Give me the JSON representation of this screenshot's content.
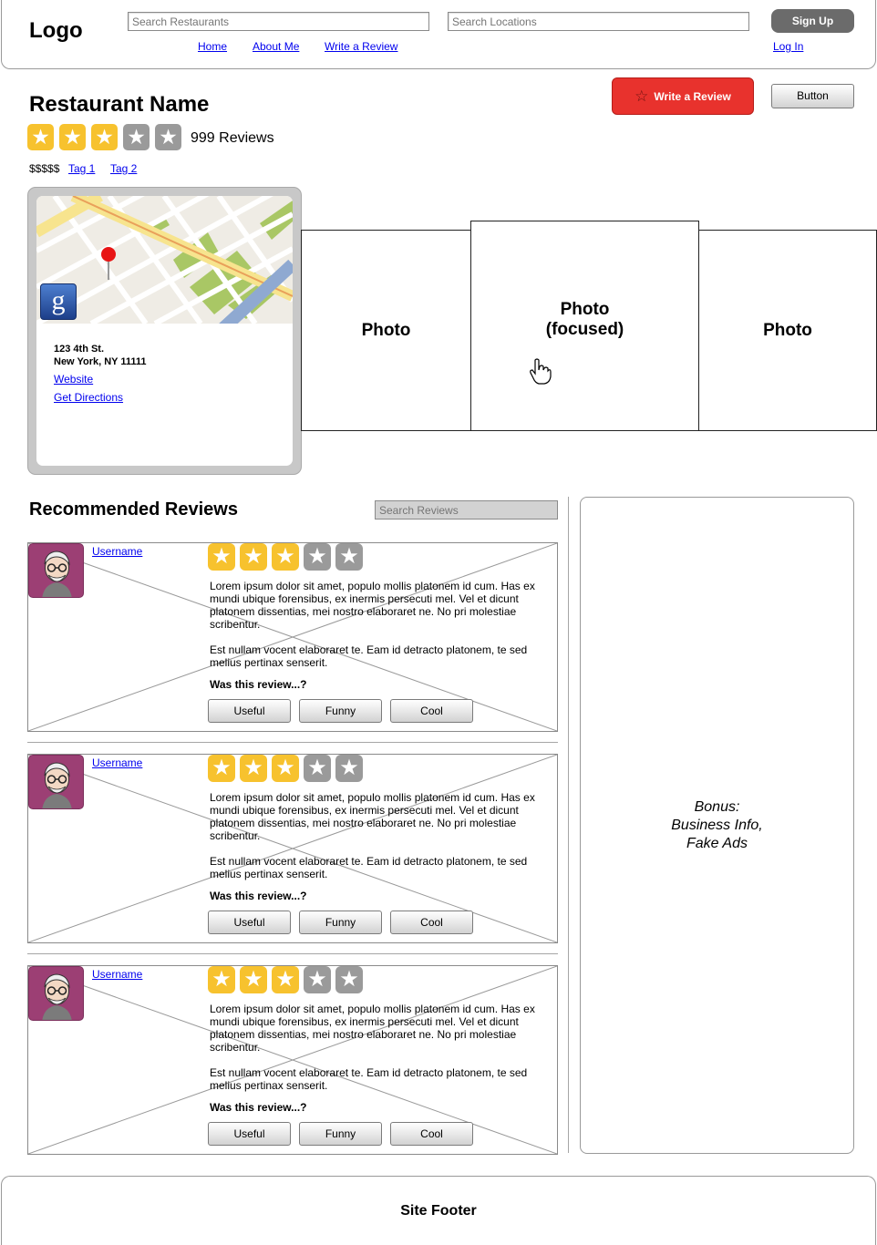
{
  "header": {
    "logo": "Logo",
    "search_restaurants_placeholder": "Search Restaurants",
    "search_locations_placeholder": "Search Locations",
    "nav": [
      {
        "label": "Home"
      },
      {
        "label": "About Me"
      },
      {
        "label": "Write a Review"
      }
    ],
    "signup_label": "Sign Up",
    "login_label": "Log In"
  },
  "restaurant": {
    "name": "Restaurant Name",
    "rating": 3,
    "rating_max": 5,
    "review_count_label": "999 Reviews",
    "price": "$$$$$",
    "tags": [
      {
        "label": "Tag 1"
      },
      {
        "label": "Tag 2"
      }
    ],
    "write_review_label": "Write a Review",
    "generic_button_label": "Button"
  },
  "location": {
    "address_line1": "123 4th St.",
    "address_line2": "New York, NY 11111",
    "website_label": "Website",
    "directions_label": "Get Directions",
    "map_badge": "g"
  },
  "photos": {
    "left": "Photo",
    "center": "Photo\n(focused)",
    "right": "Photo"
  },
  "reviews_section": {
    "heading": "Recommended Reviews",
    "search_placeholder": "Search Reviews",
    "reviews": [
      {
        "username": "Username",
        "rating": 3,
        "paragraph1": "Lorem ipsum dolor sit amet, populo mollis platonem id cum. Has ex mundi ubique forensibus, ex inermis persecuti mel. Vel et dicunt platonem dissentias, mei nostro elaboraret ne. No pri molestiae scribentur.",
        "paragraph2": "Est nullam vocent elaboraret te. Eam id detracto platonem, te sed melius pertinax senserit.",
        "prompt": "Was this review...?",
        "buttons": [
          "Useful",
          "Funny",
          "Cool"
        ]
      },
      {
        "username": "Username",
        "rating": 3,
        "paragraph1": "Lorem ipsum dolor sit amet, populo mollis platonem id cum. Has ex mundi ubique forensibus, ex inermis persecuti mel. Vel et dicunt platonem dissentias, mei nostro elaboraret ne. No pri molestiae scribentur.",
        "paragraph2": "Est nullam vocent elaboraret te. Eam id detracto platonem, te sed melius pertinax senserit.",
        "prompt": "Was this review...?",
        "buttons": [
          "Useful",
          "Funny",
          "Cool"
        ]
      },
      {
        "username": "Username",
        "rating": 3,
        "paragraph1": "Lorem ipsum dolor sit amet, populo mollis platonem id cum. Has ex mundi ubique forensibus, ex inermis persecuti mel. Vel et dicunt platonem dissentias, mei nostro elaboraret ne. No pri molestiae scribentur.",
        "paragraph2": "Est nullam vocent elaboraret te. Eam id detracto platonem, te sed melius pertinax senserit.",
        "prompt": "Was this review...?",
        "buttons": [
          "Useful",
          "Funny",
          "Cool"
        ]
      }
    ]
  },
  "side_panel": {
    "text": "Bonus:\nBusiness Info,\nFake Ads"
  },
  "footer": {
    "text": "Site Footer"
  },
  "colors": {
    "star_on": "#f7c22e",
    "star_off": "#9a9a9a",
    "write_review_red": "#e8322d",
    "avatar_purple": "#9c3f74",
    "signup_gray": "#6b6b6b"
  },
  "icons": {
    "star": "star-icon",
    "map_pin": "map-pin-icon",
    "google_badge": "google-icon",
    "cursor": "hand-cursor-icon",
    "avatar": "user-avatar-icon"
  }
}
